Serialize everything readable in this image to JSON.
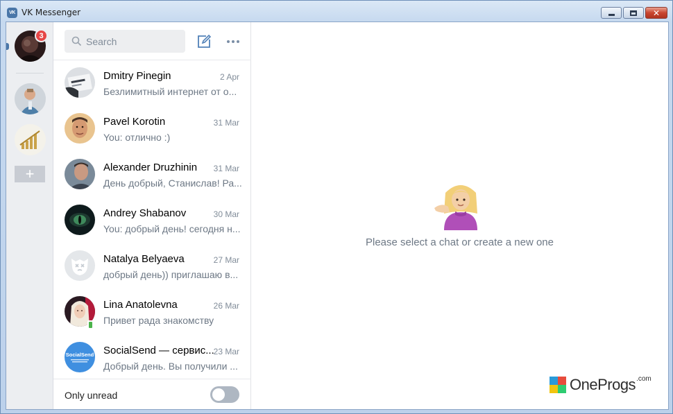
{
  "window": {
    "title": "VK Messenger",
    "logo_text": "VK",
    "buttons": {
      "minimize": "minimize",
      "maximize": "maximize",
      "close": "✕"
    }
  },
  "rail": {
    "accounts": [
      {
        "name": "current-account",
        "badge": "3",
        "selected": true
      },
      {
        "name": "account-2"
      },
      {
        "name": "account-3"
      }
    ],
    "add_label": "+"
  },
  "search": {
    "placeholder": "Search"
  },
  "chats": [
    {
      "name": "Dmitry Pinegin",
      "date": "2 Apr",
      "preview": "Безлимитный интернет от о..."
    },
    {
      "name": "Pavel Korotin",
      "date": "31 Mar",
      "preview": "You: отлично :)"
    },
    {
      "name": "Alexander Druzhinin",
      "date": "31 Mar",
      "preview": "День добрый, Станислав! Ра..."
    },
    {
      "name": "Andrey Shabanov",
      "date": "30 Mar",
      "preview": "You: добрый день! сегодня н..."
    },
    {
      "name": "Natalya Belyaeva",
      "date": "27 Mar",
      "preview": "добрый день)) приглашаю в..."
    },
    {
      "name": "Lina Anatolevna",
      "date": "26 Mar",
      "preview": "Привет рада знакомству",
      "online_mobile": true
    },
    {
      "name": "SocialSend — сервис...",
      "date": "23 Mar",
      "preview": "Добрый день. Вы получили ...",
      "avatar_text": "SocialSend"
    }
  ],
  "footer": {
    "only_unread_label": "Only unread",
    "only_unread_on": false
  },
  "empty_state": {
    "message": "Please select a chat or create a new one"
  },
  "watermark": {
    "text": "OneProgs",
    "suffix": ".com"
  },
  "colors": {
    "accent": "#4a76a8",
    "badge": "#e64646",
    "online": "#4bb34b",
    "muted_text": "#6d7885"
  }
}
